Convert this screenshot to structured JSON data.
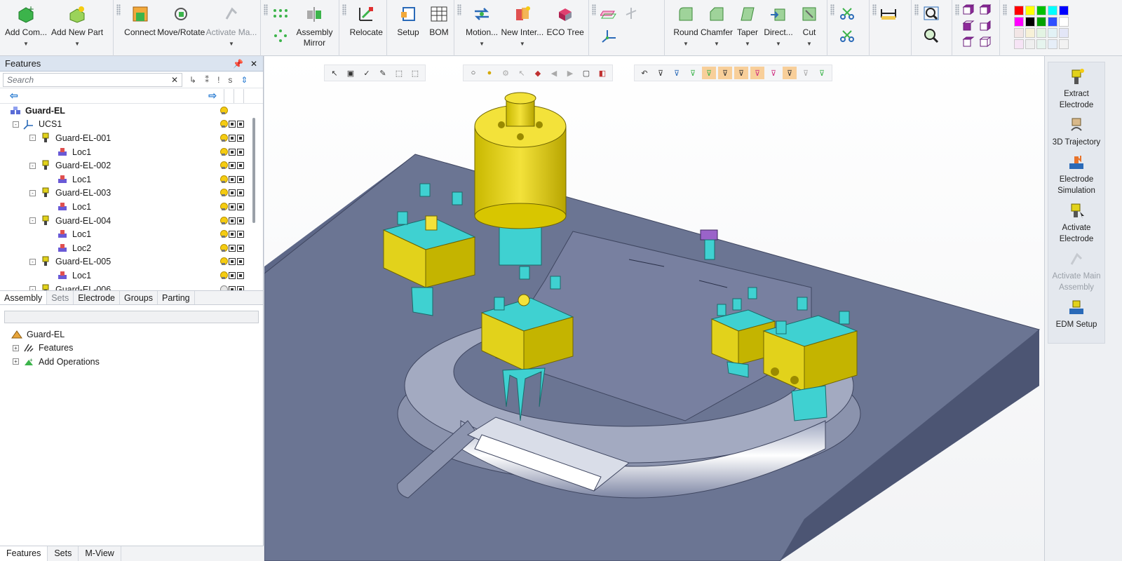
{
  "ribbon": {
    "groups": [
      {
        "buttons": [
          {
            "label": "Add Com...",
            "dropdown": true
          },
          {
            "label": "Add New Part",
            "dropdown": true
          }
        ]
      },
      {
        "buttons": [
          {
            "label": "Connect"
          },
          {
            "label": "Move/Rotate"
          },
          {
            "label": "Activate Ma...",
            "disabled": true,
            "dropdown": true
          }
        ]
      },
      {
        "buttons": [
          {
            "label": "Assembly Mirror"
          }
        ]
      },
      {
        "buttons": [
          {
            "label": "Relocate"
          }
        ]
      },
      {
        "buttons": [
          {
            "label": "Setup"
          },
          {
            "label": "BOM"
          }
        ]
      },
      {
        "buttons": [
          {
            "label": "Motion...",
            "dropdown": true
          },
          {
            "label": "New Inter...",
            "dropdown": true
          },
          {
            "label": "ECO Tree"
          }
        ]
      },
      {
        "buttons": [
          {
            "label": "Round",
            "dropdown": true
          },
          {
            "label": "Chamfer",
            "dropdown": true
          },
          {
            "label": "Taper",
            "dropdown": true
          },
          {
            "label": "Direct...",
            "dropdown": true
          },
          {
            "label": "Cut",
            "dropdown": true
          }
        ]
      }
    ],
    "palette_colors": [
      "#ff0000",
      "#ffff00",
      "#00c000",
      "#00ffff",
      "#0000ff",
      "#ff00ff",
      "#000000",
      "#00a000",
      "#3050ff",
      "#ffffff",
      "#f2e6e6",
      "#f7f1d8",
      "#e3f4e3",
      "#e2f2f6",
      "#e3e6f7",
      "#f6e4f5",
      "#efefef",
      "#e6f4ee",
      "#e6eef8",
      "#f2f2f2"
    ]
  },
  "features_panel": {
    "title": "Features",
    "search_placeholder": "Search",
    "tree": [
      {
        "label": "Guard-EL",
        "level": 0,
        "bold": true,
        "icon": "assembly-icon"
      },
      {
        "label": "UCS1",
        "level": 1,
        "expand": "-",
        "icon": "ucs-icon"
      },
      {
        "label": "Guard-EL-001",
        "level": 2,
        "expand": "-",
        "icon": "electrode-icon"
      },
      {
        "label": "Loc1",
        "level": 3,
        "icon": "location-icon"
      },
      {
        "label": "Guard-EL-002",
        "level": 2,
        "expand": "-",
        "icon": "electrode-icon"
      },
      {
        "label": "Loc1",
        "level": 3,
        "icon": "location-icon"
      },
      {
        "label": "Guard-EL-003",
        "level": 2,
        "expand": "-",
        "icon": "electrode-icon"
      },
      {
        "label": "Loc1",
        "level": 3,
        "icon": "location-icon"
      },
      {
        "label": "Guard-EL-004",
        "level": 2,
        "expand": "-",
        "icon": "electrode-icon"
      },
      {
        "label": "Loc1",
        "level": 3,
        "icon": "location-icon"
      },
      {
        "label": "Loc2",
        "level": 3,
        "icon": "location-icon"
      },
      {
        "label": "Guard-EL-005",
        "level": 2,
        "expand": "-",
        "icon": "electrode-icon"
      },
      {
        "label": "Loc1",
        "level": 3,
        "icon": "location-icon"
      },
      {
        "label": "Guard-EL-006",
        "level": 2,
        "expand": "-",
        "icon": "electrode-icon",
        "bulb_off": true
      }
    ],
    "tabs": [
      {
        "label": "Assembly",
        "active": true
      },
      {
        "label": "Sets",
        "dim": true
      },
      {
        "label": "Electrode"
      },
      {
        "label": "Groups"
      },
      {
        "label": "Parting"
      }
    ]
  },
  "operations_panel": {
    "tree": [
      {
        "label": "Guard-EL",
        "level": 0,
        "icon": "edm-icon"
      },
      {
        "label": "Features",
        "level": 1,
        "expand": "+",
        "icon": "features-icon"
      },
      {
        "label": "Add Operations",
        "level": 1,
        "expand": "+",
        "icon": "add-operations-icon"
      }
    ]
  },
  "bottom_tabs": [
    {
      "label": "Features",
      "active": true
    },
    {
      "label": "Sets"
    },
    {
      "label": "M-View"
    }
  ],
  "right_panel": {
    "tools": [
      {
        "label": "Extract Electrode"
      },
      {
        "label": "3D Trajectory"
      },
      {
        "label": "Electrode Simulation"
      },
      {
        "label": "Activate Electrode"
      },
      {
        "label": "Activate Main Assembly",
        "disabled": true
      },
      {
        "label": "EDM Setup"
      }
    ]
  }
}
